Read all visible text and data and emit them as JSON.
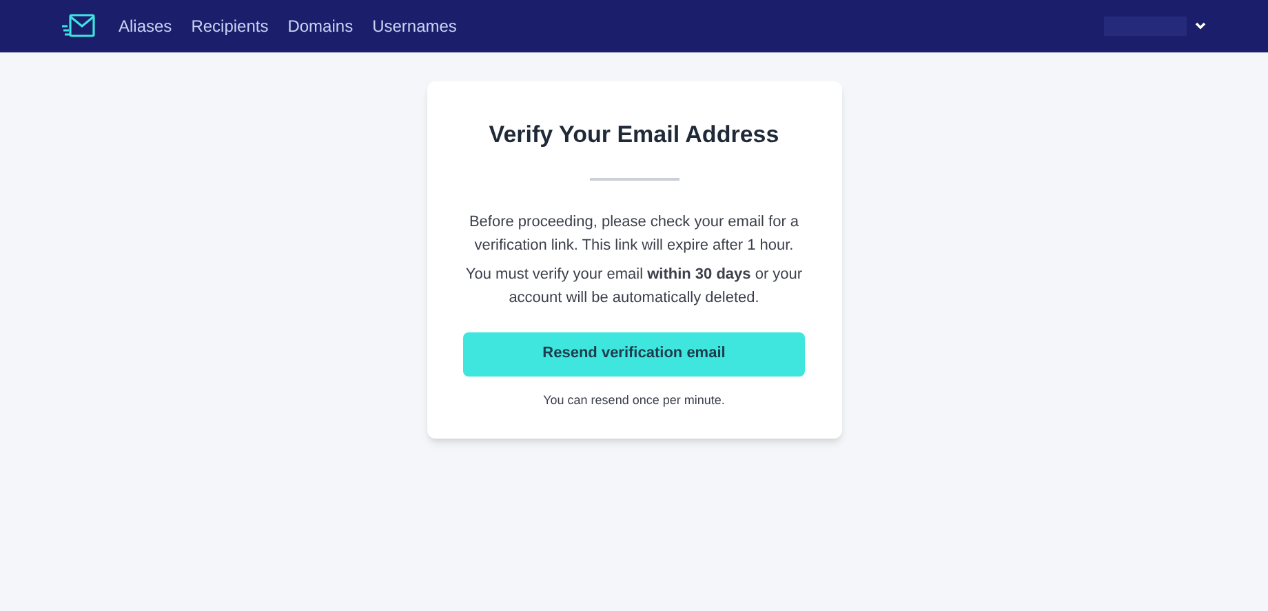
{
  "nav": {
    "links": [
      {
        "label": "Aliases"
      },
      {
        "label": "Recipients"
      },
      {
        "label": "Domains"
      },
      {
        "label": "Usernames"
      }
    ]
  },
  "card": {
    "title": "Verify Your Email Address",
    "paragraphs": [
      "Before proceeding, please check your email for a verification link. This link will expire after 1 hour.",
      "You must verify your email **within 30 days** or your account will be automatically deleted."
    ],
    "button": "Resend verification email",
    "note": "You can resend once per minute."
  }
}
